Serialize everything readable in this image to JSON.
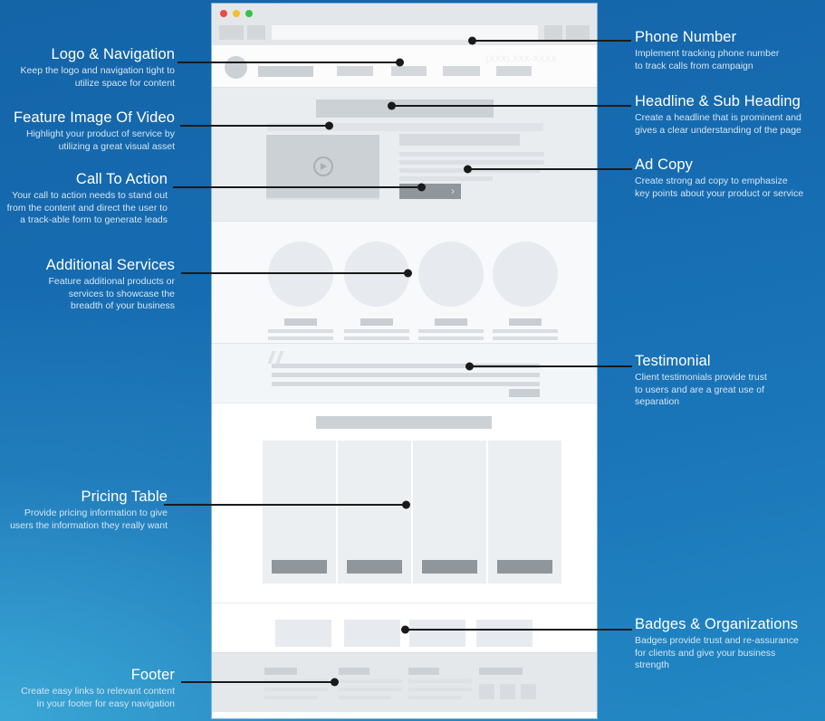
{
  "browser": {
    "window_dots": [
      "close",
      "minimize",
      "maximize"
    ],
    "phone_number": "(XXX) XXX-XXXX"
  },
  "annotations": {
    "left": [
      {
        "id": "logo-navigation",
        "title": "Logo & Navigation",
        "body": "Keep the logo and navigation tight to\nutilize space for content"
      },
      {
        "id": "feature-image-video",
        "title": "Feature Image Of Video",
        "body": "Highlight your product of service by\nutilizing a great visual asset"
      },
      {
        "id": "call-to-action",
        "title": "Call To Action",
        "body": "Your call to action needs to stand out\nfrom the content and direct the user to\na track-able form to generate leads"
      },
      {
        "id": "additional-services",
        "title": "Additional Services",
        "body": "Feature additional products or\nservices to showcase the\nbreadth of your business"
      },
      {
        "id": "pricing-table",
        "title": "Pricing Table",
        "body": "Provide pricing information to give\nusers the information they really want"
      },
      {
        "id": "footer",
        "title": "Footer",
        "body": "Create easy links to relevant content\nin your footer for easy navigation"
      }
    ],
    "right": [
      {
        "id": "phone-number",
        "title": "Phone Number",
        "body": "Implement tracking phone number\nto track calls from campaign"
      },
      {
        "id": "headline-sub-heading",
        "title": "Headline & Sub Heading",
        "body": "Create a headline that is prominent and\ngives a clear understanding of the page"
      },
      {
        "id": "ad-copy",
        "title": "Ad Copy",
        "body": "Create strong ad copy to emphasize\nkey points about your product or service"
      },
      {
        "id": "testimonial",
        "title": "Testimonial",
        "body": "Client testimonials provide trust\nto users and are a great use of\nseparation"
      },
      {
        "id": "badges-organizations",
        "title": "Badges & Organizations",
        "body": "Badges provide trust and re-assurance\nfor clients and give your business\nstrength"
      }
    ]
  },
  "colors": {
    "background_top": "#1464a8",
    "background_bottom": "#2288c4",
    "leader_line": "#1a1a1a",
    "title_text": "#ffffff",
    "body_text": "#d5e6f3",
    "wireframe_light": "#e9edf0",
    "wireframe_mid": "#ccd1d6",
    "wireframe_dark": "#8f969c"
  },
  "icons": {
    "play": "play-icon",
    "chevron": "chevron-right-icon",
    "quote": "quote-icon"
  }
}
